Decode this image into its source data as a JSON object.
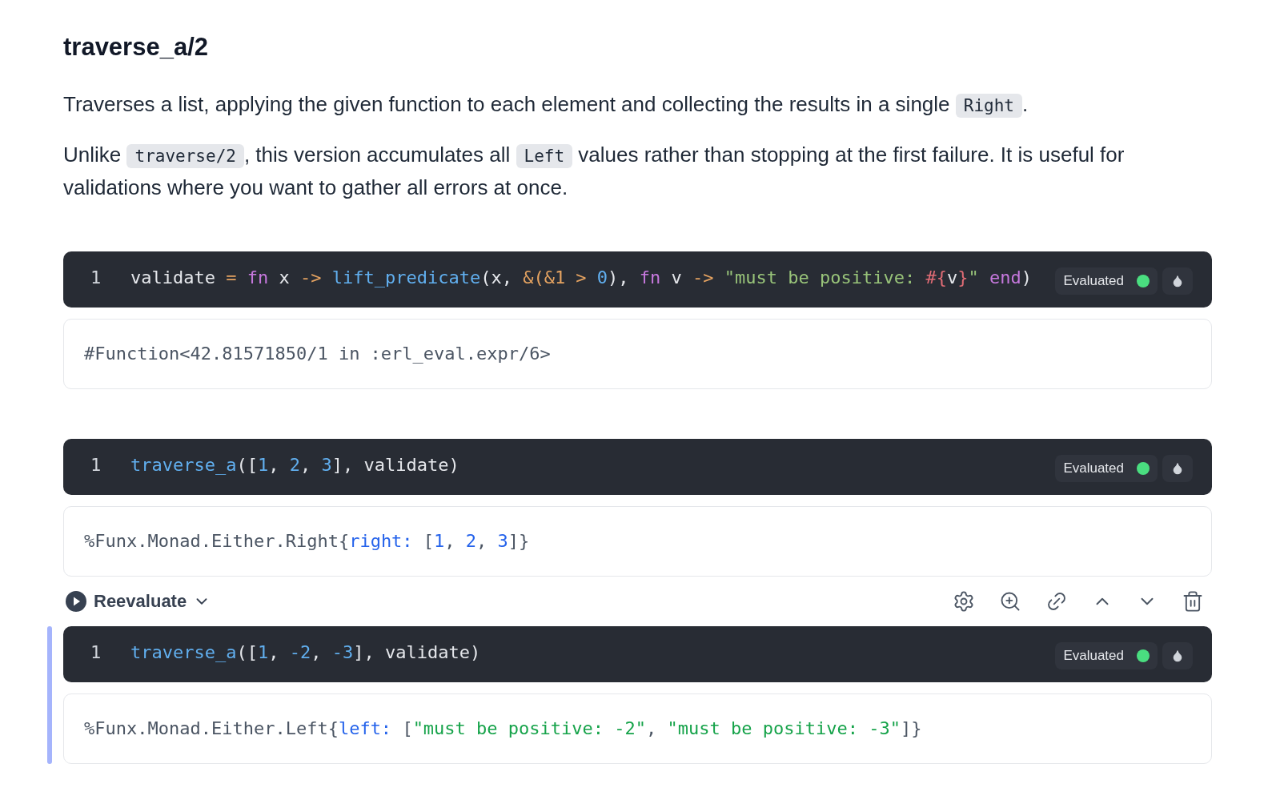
{
  "title": "traverse_a/2",
  "paragraphs": [
    [
      {
        "kind": "text",
        "text": "Traverses a list, applying the given function to each element and collecting the results in a single "
      },
      {
        "kind": "code",
        "text": "Right"
      },
      {
        "kind": "text",
        "text": "."
      }
    ],
    [
      {
        "kind": "text",
        "text": "Unlike "
      },
      {
        "kind": "code",
        "text": "traverse/2"
      },
      {
        "kind": "text",
        "text": ", this version accumulates all "
      },
      {
        "kind": "code",
        "text": "Left"
      },
      {
        "kind": "text",
        "text": " values rather than stopping at the first failure. It is useful for validations where you want to gather all errors at once."
      }
    ]
  ],
  "cells": [
    {
      "focused": false,
      "line_number": "1",
      "status": "Evaluated",
      "color": "#4ade80",
      "code": [
        {
          "kind": "plain",
          "text": "validate "
        },
        {
          "kind": "operator",
          "text": "= "
        },
        {
          "kind": "keyword",
          "text": "fn"
        },
        {
          "kind": "plain",
          "text": " x "
        },
        {
          "kind": "operator",
          "text": "-> "
        },
        {
          "kind": "function",
          "text": "lift_predicate"
        },
        {
          "kind": "plain",
          "text": "(x, "
        },
        {
          "kind": "operator",
          "text": "&(&1 > "
        },
        {
          "kind": "number",
          "text": "0"
        },
        {
          "kind": "plain",
          "text": "), "
        },
        {
          "kind": "keyword",
          "text": "fn"
        },
        {
          "kind": "plain",
          "text": " v "
        },
        {
          "kind": "operator",
          "text": "-> "
        },
        {
          "kind": "string",
          "text": "\"must be positive: "
        },
        {
          "kind": "interp",
          "text": "#{"
        },
        {
          "kind": "plain",
          "text": "v"
        },
        {
          "kind": "interp",
          "text": "}"
        },
        {
          "kind": "string",
          "text": "\" "
        },
        {
          "kind": "keyword",
          "text": "end"
        },
        {
          "kind": "plain",
          "text": ")"
        }
      ],
      "output": [
        {
          "kind": "plain",
          "text": "#Function<42.81571850/1 in :erl_eval.expr/6>"
        }
      ]
    },
    {
      "focused": false,
      "line_number": "1",
      "status": "Evaluated",
      "color": "#4ade80",
      "code": [
        {
          "kind": "function",
          "text": "traverse_a"
        },
        {
          "kind": "plain",
          "text": "(["
        },
        {
          "kind": "number",
          "text": "1"
        },
        {
          "kind": "plain",
          "text": ", "
        },
        {
          "kind": "number",
          "text": "2"
        },
        {
          "kind": "plain",
          "text": ", "
        },
        {
          "kind": "number",
          "text": "3"
        },
        {
          "kind": "plain",
          "text": "], validate)"
        }
      ],
      "output": [
        {
          "kind": "plain",
          "text": "%Funx.Monad.Either.Right{"
        },
        {
          "kind": "key",
          "text": "right: "
        },
        {
          "kind": "plain",
          "text": "["
        },
        {
          "kind": "number",
          "text": "1"
        },
        {
          "kind": "plain",
          "text": ", "
        },
        {
          "kind": "number",
          "text": "2"
        },
        {
          "kind": "plain",
          "text": ", "
        },
        {
          "kind": "number",
          "text": "3"
        },
        {
          "kind": "plain",
          "text": "]}"
        }
      ]
    },
    {
      "focused": true,
      "toolbar": {
        "action": "Reevaluate"
      },
      "line_number": "1",
      "status": "Evaluated",
      "color": "#4ade80",
      "code": [
        {
          "kind": "function",
          "text": "traverse_a"
        },
        {
          "kind": "plain",
          "text": "(["
        },
        {
          "kind": "number",
          "text": "1"
        },
        {
          "kind": "plain",
          "text": ", "
        },
        {
          "kind": "number",
          "text": "-2"
        },
        {
          "kind": "plain",
          "text": ", "
        },
        {
          "kind": "number",
          "text": "-3"
        },
        {
          "kind": "plain",
          "text": "], validate)"
        }
      ],
      "output": [
        {
          "kind": "plain",
          "text": "%Funx.Monad.Either.Left{"
        },
        {
          "kind": "key",
          "text": "left: "
        },
        {
          "kind": "plain",
          "text": "["
        },
        {
          "kind": "ostring",
          "text": "\"must be positive: -2\""
        },
        {
          "kind": "plain",
          "text": ", "
        },
        {
          "kind": "ostring",
          "text": "\"must be positive: -3\""
        },
        {
          "kind": "plain",
          "text": "]}"
        }
      ]
    }
  ]
}
